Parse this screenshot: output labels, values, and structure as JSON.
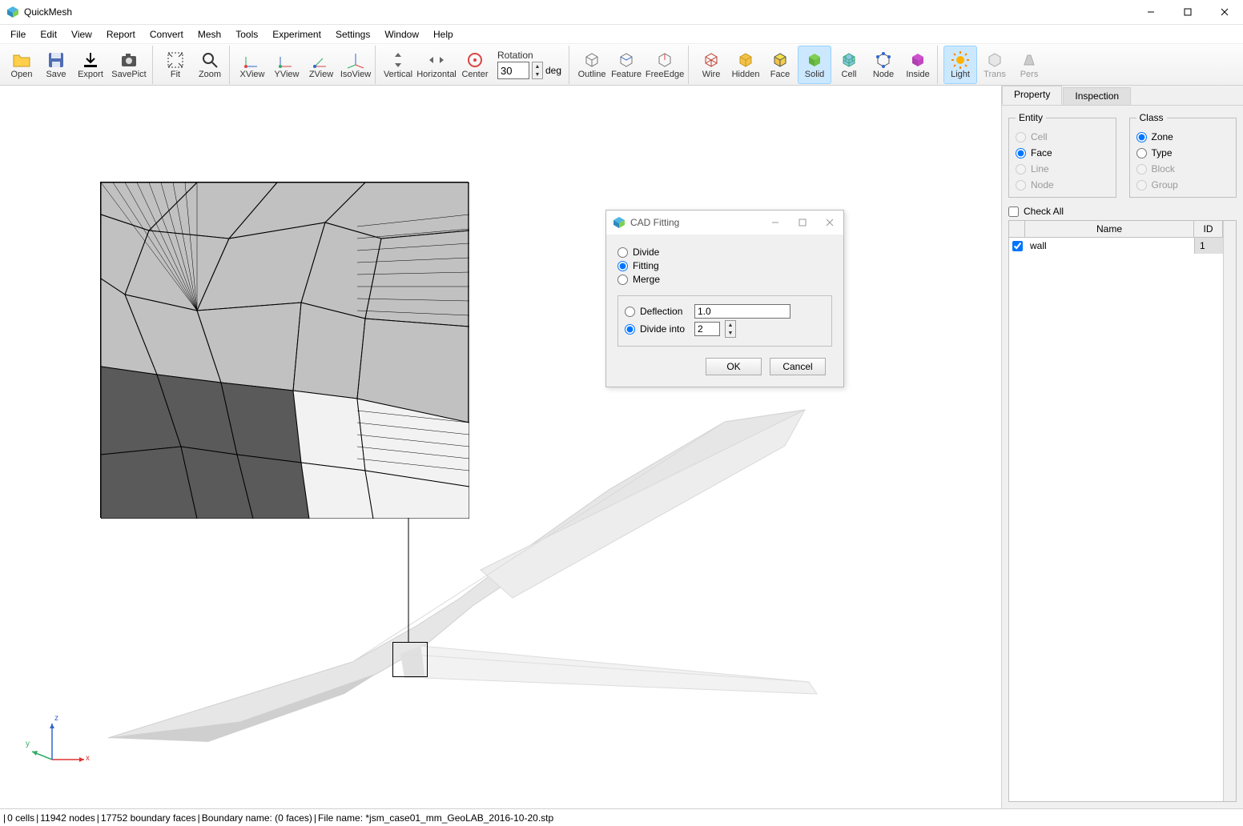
{
  "app": {
    "title": "QuickMesh"
  },
  "window_controls": {
    "min": "–",
    "max": "☐",
    "close": "✕"
  },
  "menu": [
    "File",
    "Edit",
    "View",
    "Report",
    "Convert",
    "Mesh",
    "Tools",
    "Experiment",
    "Settings",
    "Window",
    "Help"
  ],
  "toolbar": {
    "open": "Open",
    "save": "Save",
    "export": "Export",
    "savepict": "SavePict",
    "fit": "Fit",
    "zoom": "Zoom",
    "xview": "XView",
    "yview": "YView",
    "zview": "ZView",
    "isoview": "IsoView",
    "vertical": "Vertical",
    "horizontal": "Horizontal",
    "center": "Center",
    "rotation_label": "Rotation",
    "rotation_value": "30",
    "rotation_unit": "deg",
    "outline": "Outline",
    "feature": "Feature",
    "freeedge": "FreeEdge",
    "wire": "Wire",
    "hidden": "Hidden",
    "face": "Face",
    "solid": "Solid",
    "cell": "Cell",
    "node": "Node",
    "inside": "Inside",
    "light": "Light",
    "trans": "Trans",
    "pers": "Pers"
  },
  "side": {
    "tabs": {
      "property": "Property",
      "inspection": "Inspection"
    },
    "entity_legend": "Entity",
    "class_legend": "Class",
    "entity": {
      "cell": "Cell",
      "face": "Face",
      "line": "Line",
      "node": "Node"
    },
    "class": {
      "zone": "Zone",
      "type": "Type",
      "block": "Block",
      "group": "Group"
    },
    "check_all": "Check All",
    "cols": {
      "name": "Name",
      "id": "ID"
    },
    "rows": [
      {
        "checked": true,
        "name": "wall",
        "id": "1"
      }
    ]
  },
  "dialog": {
    "title": "CAD Fitting",
    "opt_divide": "Divide",
    "opt_fitting": "Fitting",
    "opt_merge": "Merge",
    "deflection_label": "Deflection",
    "deflection_value": "1.0",
    "divide_into_label": "Divide into",
    "divide_into_value": "2",
    "ok": "OK",
    "cancel": "Cancel"
  },
  "status": {
    "cells": "0 cells",
    "nodes": "11942 nodes",
    "bfaces": "17752 boundary faces",
    "bname": "Boundary name:  (0 faces)",
    "fname": "File name: *jsm_case01_mm_GeoLAB_2016-10-20.stp"
  },
  "axis": {
    "x": "x",
    "y": "y",
    "z": "z"
  }
}
